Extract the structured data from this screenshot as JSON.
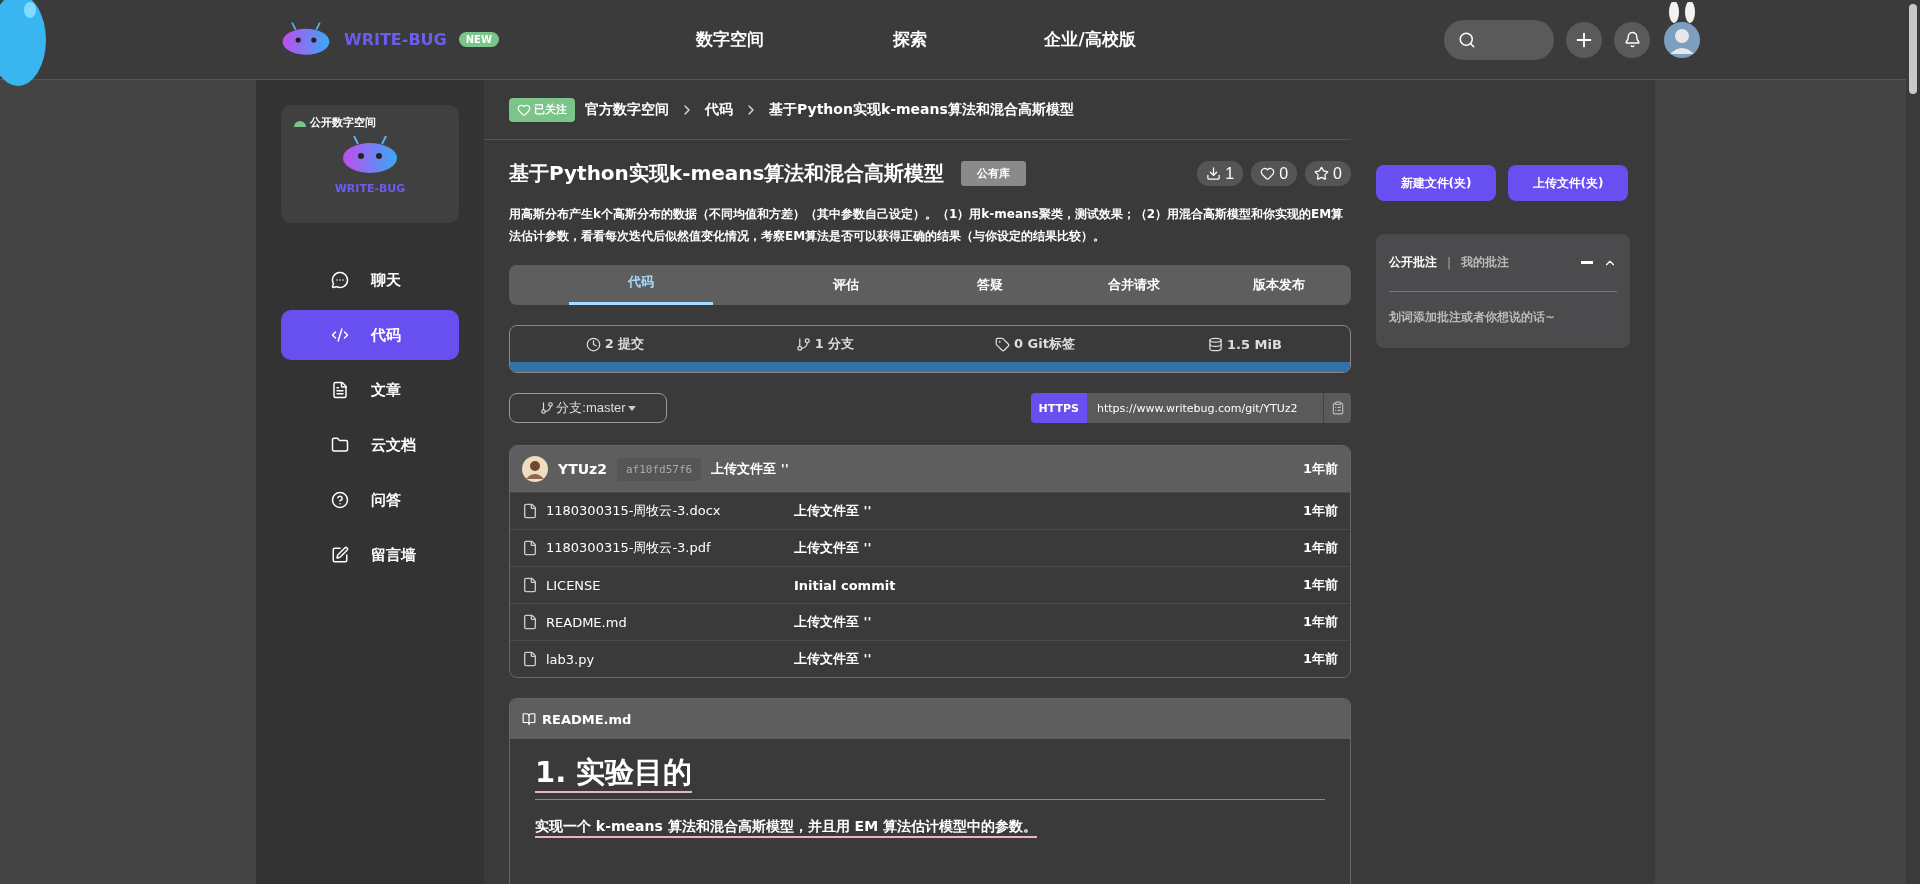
{
  "header": {
    "logo_text": "WRITE-BUG",
    "badge": "NEW",
    "nav": [
      {
        "label": "数字空间"
      },
      {
        "label": "探索"
      },
      {
        "label": "企业/高校版"
      }
    ]
  },
  "sidebar": {
    "space_label": "公开数字空间",
    "logo_text": "WRITE-BUG",
    "items": [
      {
        "label": "聊天",
        "kind": "chat",
        "selected": false
      },
      {
        "label": "代码",
        "kind": "code",
        "selected": true
      },
      {
        "label": "文章",
        "kind": "article",
        "selected": false
      },
      {
        "label": "云文档",
        "kind": "folder",
        "selected": false
      },
      {
        "label": "问答",
        "kind": "question",
        "selected": false
      },
      {
        "label": "留言墙",
        "kind": "wall",
        "selected": false
      }
    ]
  },
  "breadcrumb": {
    "follow_label": "已关注",
    "path": [
      "官方数字空间",
      "代码",
      "基于Python实现k-means算法和混合高斯模型"
    ]
  },
  "repo": {
    "title": "基于Python实现k-means算法和混合高斯模型",
    "visibility": "公有库",
    "counters": [
      {
        "kind": "download",
        "value": "1"
      },
      {
        "kind": "like",
        "value": "0"
      },
      {
        "kind": "star",
        "value": "0"
      }
    ],
    "description": "用高斯分布产生k个高斯分布的数据（不同均值和方差）（其中参数自己设定）。（1）用k-means聚类，测试效果；（2）用混合高斯模型和你实现的EM算法估计参数，看看每次迭代后似然值变化情况，考察EM算法是否可以获得正确的结果（与你设定的结果比较）。"
  },
  "tabs": [
    {
      "label": "代码",
      "selected": true
    },
    {
      "label": "评估",
      "selected": false
    },
    {
      "label": "答疑",
      "selected": false
    },
    {
      "label": "合并请求",
      "selected": false
    },
    {
      "label": "版本发布",
      "selected": false
    }
  ],
  "stats": [
    {
      "kind": "commits",
      "label": "2 提交"
    },
    {
      "kind": "branches",
      "label": "1 分支"
    },
    {
      "kind": "tags",
      "label": "0 Git标签"
    },
    {
      "kind": "size",
      "label": "1.5 MiB"
    }
  ],
  "branch": "分支:master",
  "clone": {
    "protocol": "HTTPS",
    "url": "https://www.writebug.com/git/YTUz2"
  },
  "commit": {
    "author": "YTUz2",
    "hash": "af10fd57f6",
    "message": "上传文件至 ''",
    "time": "1年前"
  },
  "files": [
    {
      "name": "1180300315-周牧云-3.docx",
      "message": "上传文件至 ''",
      "time": "1年前"
    },
    {
      "name": "1180300315-周牧云-3.pdf",
      "message": "上传文件至 ''",
      "time": "1年前"
    },
    {
      "name": "LICENSE",
      "message": "Initial commit",
      "time": "1年前"
    },
    {
      "name": "README.md",
      "message": "上传文件至 ''",
      "time": "1年前"
    },
    {
      "name": "lab3.py",
      "message": "上传文件至 ''",
      "time": "1年前"
    }
  ],
  "readme": {
    "title": "README.md",
    "heading": "1. 实验目的",
    "paragraph": "实现一个 k-means 算法和混合高斯模型，并且用 EM 算法估计模型中的参数。"
  },
  "actions": [
    "新建文件(夹)",
    "上传文件(夹)"
  ],
  "annotations": {
    "tabs": [
      {
        "label": "公开批注",
        "selected": true
      },
      {
        "label": "我的批注",
        "selected": false
      }
    ],
    "separator": "|",
    "placeholder": "划词添加批注或者你想说的话~"
  }
}
